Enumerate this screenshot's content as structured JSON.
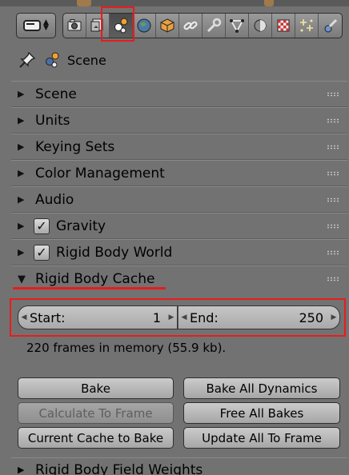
{
  "toolbar": {
    "tabs": [
      {
        "icon": "camera-render-icon"
      },
      {
        "icon": "render-layers-icon"
      },
      {
        "icon": "scene-icon",
        "active": true
      },
      {
        "icon": "world-icon"
      },
      {
        "icon": "object-icon"
      },
      {
        "icon": "constraints-icon"
      },
      {
        "icon": "modifiers-icon"
      },
      {
        "icon": "mesh-data-icon"
      },
      {
        "icon": "material-icon"
      },
      {
        "icon": "texture-icon"
      },
      {
        "icon": "particles-icon"
      },
      {
        "icon": "physics-icon"
      }
    ]
  },
  "context": {
    "label": "Scene"
  },
  "panels": {
    "scene": "Scene",
    "units": "Units",
    "keying_sets": "Keying Sets",
    "color_management": "Color Management",
    "audio": "Audio",
    "gravity": "Gravity",
    "rigid_body_world": "Rigid Body World",
    "rigid_body_cache": "Rigid Body Cache",
    "rigid_body_field_weights": "Rigid Body Field Weights"
  },
  "cache": {
    "start_label": "Start:",
    "start_value": "1",
    "end_label": "End:",
    "end_value": "250",
    "memory_text": "220 frames in memory (55.9 kb)."
  },
  "buttons": {
    "bake": "Bake",
    "bake_all_dynamics": "Bake All Dynamics",
    "calculate_to_frame": "Calculate To Frame",
    "free_all_bakes": "Free All Bakes",
    "current_cache_to_bake": "Current Cache to Bake",
    "update_all_to_frame": "Update All To Frame"
  },
  "colors": {
    "panel_bg": "#727272",
    "highlight": "#e81c1c",
    "checkbox_checked": true
  }
}
